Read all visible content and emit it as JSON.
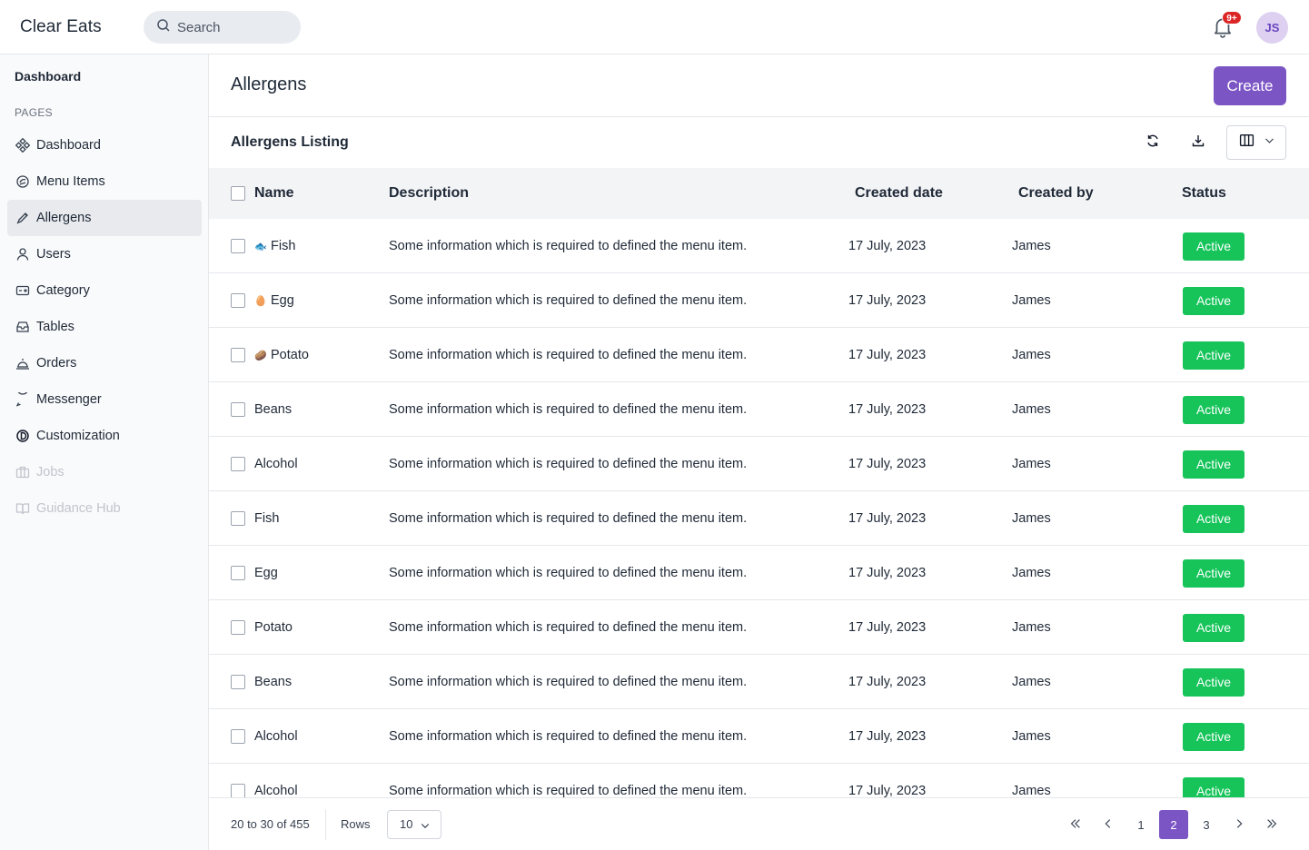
{
  "app": {
    "title": "Clear Eats"
  },
  "search": {
    "placeholder": "Search"
  },
  "notifications": {
    "badge": "9+"
  },
  "user": {
    "initials": "JS"
  },
  "sidebar": {
    "header": "Dashboard",
    "section_label": "PAGES",
    "items": [
      {
        "label": "Dashboard",
        "icon": "dashboard-icon",
        "state": "normal"
      },
      {
        "label": "Menu Items",
        "icon": "menu-items-icon",
        "state": "normal"
      },
      {
        "label": "Allergens",
        "icon": "allergens-icon",
        "state": "active"
      },
      {
        "label": "Users",
        "icon": "user-icon",
        "state": "normal"
      },
      {
        "label": "Category",
        "icon": "category-icon",
        "state": "normal"
      },
      {
        "label": "Tables",
        "icon": "tables-icon",
        "state": "normal"
      },
      {
        "label": "Orders",
        "icon": "orders-icon",
        "state": "normal"
      },
      {
        "label": "Messenger",
        "icon": "messenger-icon",
        "state": "normal"
      },
      {
        "label": "Customization",
        "icon": "customization-icon",
        "state": "normal"
      },
      {
        "label": "Jobs",
        "icon": "jobs-icon",
        "state": "disabled"
      },
      {
        "label": "Guidance Hub",
        "icon": "book-icon",
        "state": "disabled"
      }
    ]
  },
  "page": {
    "title": "Allergens",
    "create_label": "Create"
  },
  "listing": {
    "title": "Allergens Listing"
  },
  "table": {
    "headers": {
      "name": "Name",
      "description": "Description",
      "created_date": "Created date",
      "created_by": "Created by",
      "status": "Status"
    },
    "rows": [
      {
        "emoji": "🐟",
        "name": "Fish",
        "description": "Some information which is required to defined the menu item.",
        "created_date": "17 July, 2023",
        "created_by": "James",
        "status": "Active"
      },
      {
        "emoji": "🥚",
        "name": "Egg",
        "description": "Some information which is required to defined the menu item.",
        "created_date": "17 July, 2023",
        "created_by": "James",
        "status": "Active"
      },
      {
        "emoji": "🥔",
        "name": "Potato",
        "description": "Some information which is required to defined the menu item.",
        "created_date": "17 July, 2023",
        "created_by": "James",
        "status": "Active"
      },
      {
        "emoji": "",
        "name": "Beans",
        "description": "Some information which is required to defined the menu item.",
        "created_date": "17 July, 2023",
        "created_by": "James",
        "status": "Active"
      },
      {
        "emoji": "",
        "name": "Alcohol",
        "description": "Some information which is required to defined the menu item.",
        "created_date": "17 July, 2023",
        "created_by": "James",
        "status": "Active"
      },
      {
        "emoji": "",
        "name": "Fish",
        "description": "Some information which is required to defined the menu item.",
        "created_date": "17 July, 2023",
        "created_by": "James",
        "status": "Active"
      },
      {
        "emoji": "",
        "name": "Egg",
        "description": "Some information which is required to defined the menu item.",
        "created_date": "17 July, 2023",
        "created_by": "James",
        "status": "Active"
      },
      {
        "emoji": "",
        "name": "Potato",
        "description": "Some information which is required to defined the menu item.",
        "created_date": "17 July, 2023",
        "created_by": "James",
        "status": "Active"
      },
      {
        "emoji": "",
        "name": "Beans",
        "description": "Some information which is required to defined the menu item.",
        "created_date": "17 July, 2023",
        "created_by": "James",
        "status": "Active"
      },
      {
        "emoji": "",
        "name": "Alcohol",
        "description": "Some information which is required to defined the menu item.",
        "created_date": "17 July, 2023",
        "created_by": "James",
        "status": "Active"
      },
      {
        "emoji": "",
        "name": "Alcohol",
        "description": "Some information which is required to defined the menu item.",
        "created_date": "17 July, 2023",
        "created_by": "James",
        "status": "Active"
      }
    ]
  },
  "pagination": {
    "range": "20 to 30 of 455",
    "rows_label": "Rows",
    "rows_value": "10",
    "pages": [
      "1",
      "2",
      "3"
    ],
    "current_page": "2"
  },
  "colors": {
    "accent": "#7c55c5",
    "status_active": "#16c45a",
    "badge": "#dc2626"
  }
}
